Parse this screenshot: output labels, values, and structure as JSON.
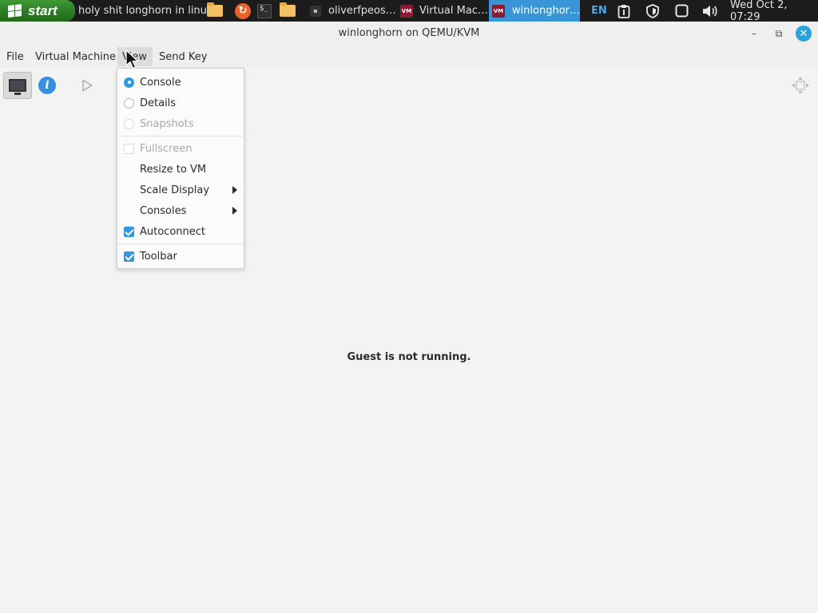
{
  "taskbar": {
    "start_label": "start",
    "task_holy": "holy shit longhorn in linux",
    "task_oliver": "oliverfpeos…",
    "task_virtman": "Virtual Mac…",
    "task_winlonghorn": "winlonghor…",
    "vm_icon_text": "VM",
    "firefox_glyph": "↻",
    "terminal_glyph": "$_",
    "terminal_small_glyph": "▪",
    "keyboard_layout": "EN",
    "clock": "Wed Oct  2, 07:29",
    "accent_color": "#3996d6"
  },
  "window": {
    "title": "winlonghorn on QEMU/KVM",
    "minimize_glyph": "–",
    "maximize_glyph": "⧉",
    "close_glyph": "✕"
  },
  "menubar": {
    "file": "File",
    "virtual_machine": "Virtual Machine",
    "view": "View",
    "send_key": "Send Key"
  },
  "toolbar": {
    "info_glyph": "i"
  },
  "view_menu": {
    "console": "Console",
    "details": "Details",
    "snapshots": "Snapshots",
    "fullscreen": "Fullscreen",
    "resize_to_vm": "Resize to VM",
    "scale_display": "Scale Display",
    "consoles": "Consoles",
    "autoconnect": "Autoconnect",
    "toolbar": "Toolbar"
  },
  "main": {
    "status_message": "Guest is not running."
  }
}
